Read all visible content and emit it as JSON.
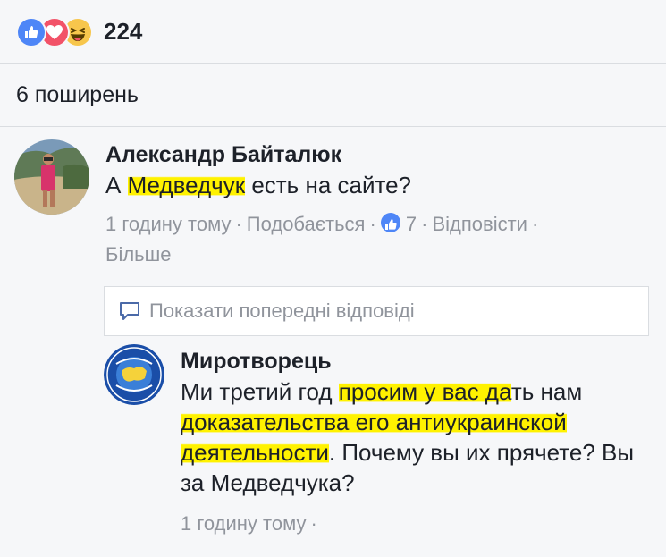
{
  "reactions": {
    "count": "224",
    "icons": [
      "like-icon",
      "love-icon",
      "haha-icon"
    ],
    "colors": {
      "like": "#4e86f7",
      "love": "#f25268",
      "haha": "#f7c64c"
    }
  },
  "shares": {
    "label": "6 поширень"
  },
  "comment1": {
    "author": "Александр Байталюк",
    "text_before": "А ",
    "text_highlight": "Медведчук",
    "text_after": " есть на сайте?",
    "time": "1 годину тому",
    "like_action": "Подобається",
    "like_count": "7",
    "reply_action": "Відповісти",
    "more_action": "Більше"
  },
  "previous_replies": {
    "label": "Показати попередні відповіді"
  },
  "comment2": {
    "author": "Миротворець",
    "t1": "Ми третий год ",
    "h1": "просим у вас да",
    "t2": "ть нам ",
    "h2": "доказательства его антиукраинской деятельности",
    "t3": ". Почему вы их прячете? Вы за Медведчука?",
    "time": "1 годину тому"
  },
  "highlight_color": "#fff200"
}
